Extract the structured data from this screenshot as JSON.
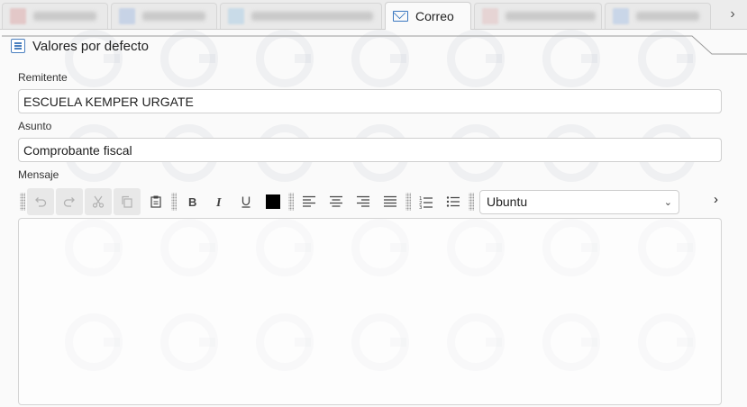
{
  "tabs": [
    {
      "label": "",
      "icon": "blurred-document-icon",
      "accent": "#e3c8c8"
    },
    {
      "label": "",
      "icon": "blurred-document-icon",
      "accent": "#c7d3e6"
    },
    {
      "label": "",
      "icon": "blurred-document-icon",
      "accent": "#c9dbe8"
    },
    {
      "label": "Correo",
      "icon": "mail-icon",
      "active": true
    },
    {
      "label": "",
      "icon": "blurred-document-icon",
      "accent": "#e6d4d4"
    },
    {
      "label": "",
      "icon": "blurred-document-icon",
      "accent": "#c9d6e8"
    }
  ],
  "tabbar": {
    "scroll_icon": "›"
  },
  "section": {
    "title": "Valores por defecto",
    "icon": "form-icon"
  },
  "form": {
    "sender": {
      "label": "Remitente",
      "value": "ESCUELA KEMPER URGATE"
    },
    "subject": {
      "label": "Asunto",
      "value": "Comprobante fiscal"
    },
    "message": {
      "label": "Mensaje",
      "value": ""
    }
  },
  "toolbar": {
    "font": "Ubuntu",
    "text_color": "#000000",
    "overflow_icon": "›",
    "buttons": [
      "undo-icon",
      "redo-icon",
      "cut-icon",
      "copy-icon",
      "paste-icon",
      "bold-icon",
      "italic-icon",
      "underline-icon",
      "color-icon",
      "align-left-icon",
      "align-center-icon",
      "align-right-icon",
      "justify-icon",
      "ordered-list-icon",
      "bullet-list-icon"
    ]
  },
  "colors": {
    "accent": "#3b78c0",
    "border": "#cfcfcf"
  }
}
